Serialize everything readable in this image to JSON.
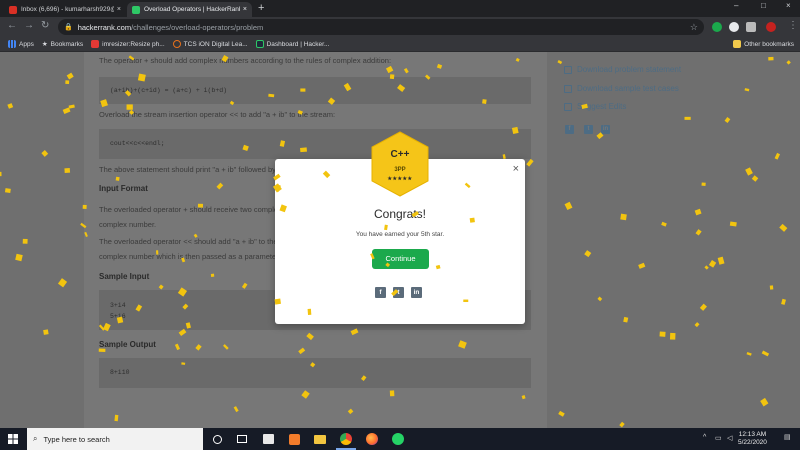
{
  "browser": {
    "tabs": [
      {
        "title": "Inbox (6,696) - kumarharsh929@...",
        "close": "×"
      },
      {
        "title": "Overload Operators | HackerRank",
        "close": "×"
      }
    ],
    "new_tab": "+",
    "window_controls": {
      "minimize": "–",
      "maximize": "□",
      "close": "×"
    },
    "url": {
      "host": "hackerrank.com",
      "path": "/challenges/overload-operators/problem"
    },
    "bookmarks": [
      {
        "label": "Apps",
        "icon": "apps-grid-icon"
      },
      {
        "label": "Bookmarks",
        "icon": "star-icon"
      },
      {
        "label": "imresizer:Resize ph...",
        "icon": "imresizer-icon"
      },
      {
        "label": "TCS iON Digital Lea...",
        "icon": "tcs-icon"
      },
      {
        "label": "Dashboard | Hacker...",
        "icon": "hackerrank-icon"
      }
    ],
    "other_bookmarks": "Other bookmarks"
  },
  "problem": {
    "line1": "The operator + should add complex numbers according to the rules of complex addition:",
    "code1": "(a+ib)+(c+id) = (a+c) + i(b+d)",
    "line2": "Overload the stream insertion operator << to add \"a + ib\" to the stream:",
    "code2": "cout<<c<<endl;",
    "line3": "The above statement should print \"a + ib\" followed by a newline where a = c.a and b = c.b.",
    "input_heading": "Input Format",
    "input1": "The overloaded operator + should receive two complex numbers (a + ib and c + id) as parameters. It must return a single",
    "input2": "complex number.",
    "input3": "The overloaded operator << should add \"a + ib\" to the stream where a is the real part and b is the imaginary part of the",
    "input4": "complex number which is then passed as a parameter to the overloaded operator.",
    "sample_input_heading": "Sample Input",
    "sample_input": [
      "3+i4",
      "5+i6"
    ],
    "sample_output_heading": "Sample Output",
    "sample_output": "8+i10"
  },
  "sidebar": {
    "links": [
      "Download problem statement",
      "Download sample test cases",
      "Suggest Edits"
    ]
  },
  "modal": {
    "badge_lang": "C++",
    "badge_points": "3PP",
    "badge_stars": "★★★★★",
    "title": "Congrats!",
    "subtitle": "You have earned your 5th star.",
    "button": "Continue",
    "close": "×",
    "share": [
      "f",
      "t",
      "in"
    ]
  },
  "taskbar": {
    "search_placeholder": "Type here to search",
    "time": "12:13 AM",
    "date": "5/22/2020",
    "apps": [
      "cortana-icon",
      "task-view-icon",
      "store-icon",
      "xampp-icon",
      "file-explorer-icon",
      "chrome-icon",
      "firefox-icon",
      "whatsapp-icon"
    ]
  },
  "colors": {
    "accent_green": "#1ba94c",
    "badge_gold": "#f5c518",
    "confetti": "#f2c40f"
  }
}
